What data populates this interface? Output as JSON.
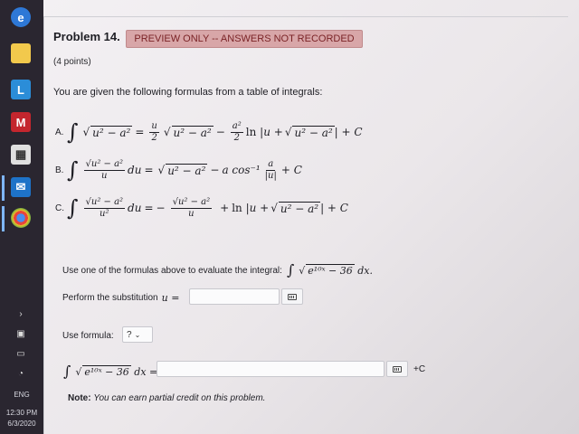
{
  "taskbar": {
    "icons": [
      "edge-icon",
      "file-explorer-icon",
      "l-app-icon",
      "mcafee-icon",
      "store-icon",
      "mail-icon",
      "chrome-icon"
    ],
    "language": "ENG",
    "time": "12:30 PM",
    "date": "6/3/2020"
  },
  "problem": {
    "title": "Problem 14.",
    "banner": "PREVIEW ONLY -- ANSWERS NOT RECORDED",
    "points": "(4 points)",
    "intro": "You are given the following formulas from a table of integrals:",
    "formulas": [
      {
        "label": "A."
      },
      {
        "label": "B."
      },
      {
        "label": "C."
      }
    ],
    "evaluate_prompt": "Use one of the formulas above to evaluate the integral:",
    "substitution_prompt": "Perform the substitution",
    "use_formula_label": "Use formula:",
    "formula_select_value": "?",
    "plus_c": "+C",
    "note_label": "Note:",
    "note_text": "You can earn partial credit on this problem."
  },
  "colors": {
    "banner_bg": "#d8a6a8",
    "banner_text": "#7a2326"
  }
}
